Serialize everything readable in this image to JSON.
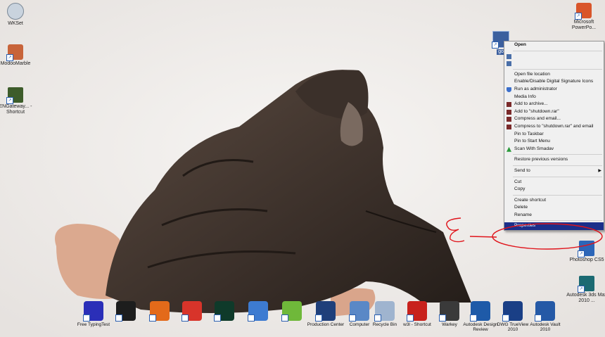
{
  "desktop_icons_left": [
    {
      "label": "WKSet"
    },
    {
      "label": "ModooMarble"
    },
    {
      "label": "ENGateway... - Shortcut"
    }
  ],
  "desktop_icons_right": [
    {
      "label": "Microsoft PowerPo..."
    },
    {
      "label": "Photoshop CS5"
    },
    {
      "label": "Autodesk 3ds Max 2010 ..."
    }
  ],
  "selected_icon_label": "go",
  "taskbar_icons": [
    {
      "label": "Free TypingTest",
      "color": "#2b2fb8"
    },
    {
      "label": "",
      "color": "#1d1d1d"
    },
    {
      "label": "",
      "color": "#e36a1a"
    },
    {
      "label": "",
      "color": "#d8342a"
    },
    {
      "label": "",
      "color": "#0f3a2a"
    },
    {
      "label": "",
      "color": "#3d7bd1"
    },
    {
      "label": "",
      "color": "#6fb83a"
    },
    {
      "label": "Production Center",
      "color": "#1f3f7a"
    },
    {
      "label": "Computer",
      "color": "#5a88c6"
    },
    {
      "label": "Recycle Bin",
      "color": "#9fb4cf"
    },
    {
      "label": "w3l - Shortcut",
      "color": "#c8211c"
    },
    {
      "label": "Warkey",
      "color": "#3a3a3a"
    },
    {
      "label": "Autodesk Design Review",
      "color": "#1e5aa8"
    },
    {
      "label": "DWG TrueView 2010",
      "color": "#1a3f86"
    },
    {
      "label": "Autodesk Vault 2010",
      "color": "#2559a6"
    }
  ],
  "context_menu": {
    "items": [
      {
        "label": "Open",
        "bold": true,
        "icon": ""
      },
      {
        "sep": true
      },
      {
        "label": "",
        "icon": "shortcut-arrow-icon"
      },
      {
        "label": "",
        "icon": "shortcut-arrow-icon"
      },
      {
        "sep": true
      },
      {
        "label": "Open file location",
        "icon": ""
      },
      {
        "label": "Enable/Disable Digital Signature Icons",
        "icon": ""
      },
      {
        "label": "Run as administrator",
        "icon": "uac-shield-icon"
      },
      {
        "label": "Media Info",
        "icon": ""
      },
      {
        "label": "Add to archive...",
        "icon": "winrar-icon"
      },
      {
        "label": "Add to \"shutdown.rar\"",
        "icon": "winrar-icon"
      },
      {
        "label": "Compress and email...",
        "icon": "winrar-icon"
      },
      {
        "label": "Compress to \"shutdown.rar\" and email",
        "icon": "winrar-icon"
      },
      {
        "label": "Pin to Taskbar",
        "icon": ""
      },
      {
        "label": "Pin to Start Menu",
        "icon": ""
      },
      {
        "label": "Scan With Smadav",
        "icon": "smadav-icon"
      },
      {
        "sep": true
      },
      {
        "label": "Restore previous versions",
        "icon": ""
      },
      {
        "sep": true
      },
      {
        "label": "Send to",
        "icon": "",
        "submenu": true
      },
      {
        "sep": true
      },
      {
        "label": "Cut",
        "icon": ""
      },
      {
        "label": "Copy",
        "icon": ""
      },
      {
        "sep": true
      },
      {
        "label": "Create shortcut",
        "icon": ""
      },
      {
        "label": "Delete",
        "icon": ""
      },
      {
        "label": "Rename",
        "icon": ""
      },
      {
        "sep": true
      },
      {
        "label": "Properties",
        "icon": "",
        "selected": true
      }
    ]
  },
  "colors": {
    "menu_highlight": "#1b2f8a",
    "annotation_red": "#e0141b"
  }
}
